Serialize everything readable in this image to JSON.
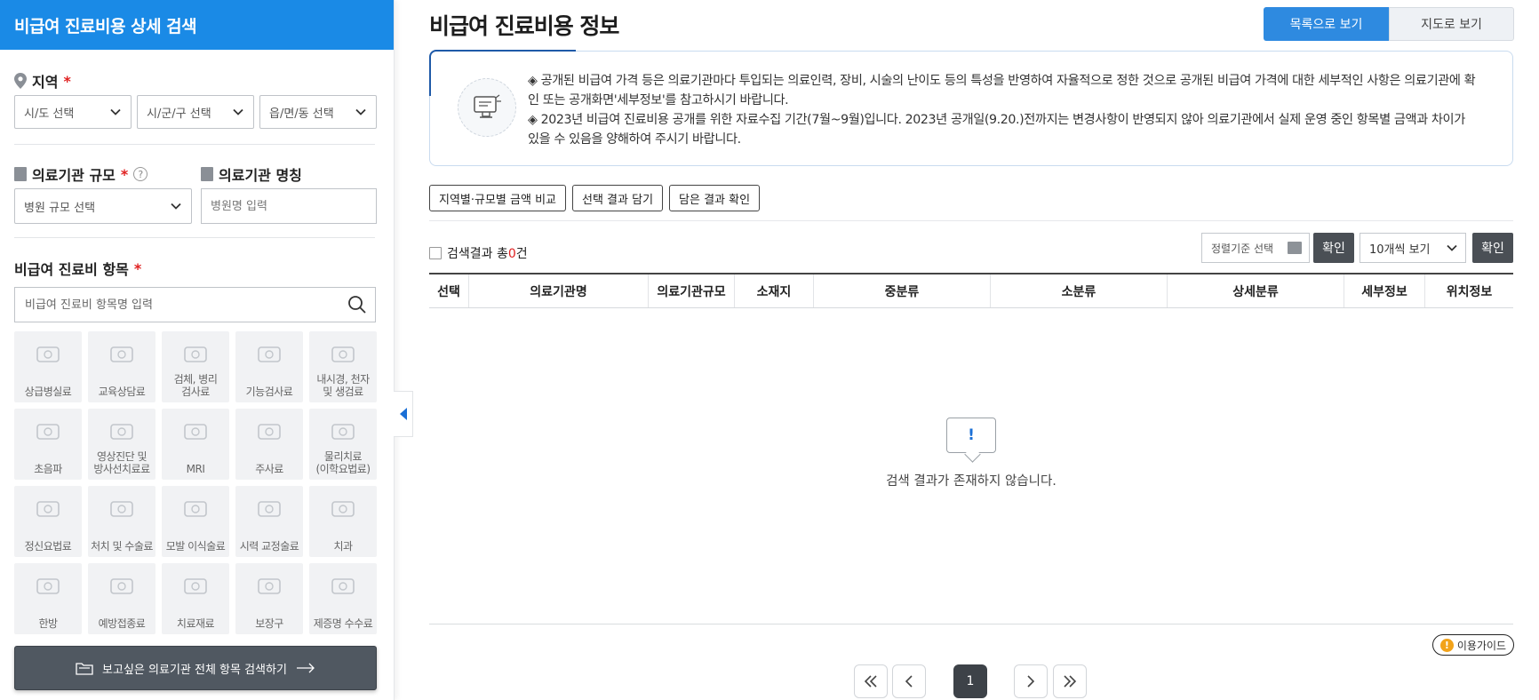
{
  "sidebar": {
    "title": "비급여 진료비용 상세 검색",
    "region": {
      "label": "지역",
      "required": "*",
      "sido": "시/도 선택",
      "sigungu": "시/군/구 선택",
      "dong": "읍/면/동 선택"
    },
    "scale": {
      "label": "의료기관 규모",
      "required": "*",
      "help": "?",
      "select": "병원 규모 선택"
    },
    "name": {
      "label": "의료기관 명칭",
      "placeholder": "병원명 입력"
    },
    "items": {
      "label": "비급여 진료비 항목",
      "required": "*",
      "search_placeholder": "비급여 진료비 항목명 입력",
      "categories": [
        {
          "label": "상급병실료",
          "icon": "bed-icon"
        },
        {
          "label": "교육상담료",
          "icon": "counseling-icon"
        },
        {
          "label": "검체, 병리\n검사료",
          "icon": "specimen-icon"
        },
        {
          "label": "기능검사료",
          "icon": "function-test-icon"
        },
        {
          "label": "내시경, 천자\n및 생검료",
          "icon": "endoscope-icon"
        },
        {
          "label": "초음파",
          "icon": "ultrasound-icon"
        },
        {
          "label": "영상진단 및\n방사선치료료",
          "icon": "radiology-icon"
        },
        {
          "label": "MRI",
          "icon": "mri-icon"
        },
        {
          "label": "주사료",
          "icon": "injection-icon"
        },
        {
          "label": "물리치료\n(이학요법료)",
          "icon": "physical-therapy-icon"
        },
        {
          "label": "정신요법료",
          "icon": "psychotherapy-icon"
        },
        {
          "label": "처치 및 수술료",
          "icon": "surgery-icon"
        },
        {
          "label": "모발 이식술료",
          "icon": "hair-transplant-icon"
        },
        {
          "label": "시력 교정술료",
          "icon": "eye-icon"
        },
        {
          "label": "치과",
          "icon": "tooth-icon"
        },
        {
          "label": "한방",
          "icon": "ear-icon"
        },
        {
          "label": "예방접종료",
          "icon": "vaccine-icon"
        },
        {
          "label": "치료재료",
          "icon": "material-icon"
        },
        {
          "label": "보장구",
          "icon": "wheelchair-icon"
        },
        {
          "label": "제증명 수수료",
          "icon": "certificate-icon"
        }
      ]
    },
    "full_search_button": "보고싶은 의료기관 전체 항목 검색하기"
  },
  "main": {
    "title": "비급여 진료비용 정보",
    "view_tabs": {
      "list": "목록으로 보기",
      "map": "지도로 보기"
    },
    "notice_lines": [
      "◈ 공개된 비급여 가격 등은 의료기관마다 투입되는 의료인력, 장비, 시술의 난이도 등의 특성을 반영하여 자율적으로 정한 것으로 공개된 비급여 가격에 대한 세부적인 사항은 의료기관에 확인 또는 공개화면'세부정보'를 참고하시기 바랍니다.",
      "◈ 2023년 비급여 진료비용 공개를 위한 자료수집 기간(7월~9월)입니다. 2023년 공개일(9.20.)전까지는 변경사항이 반영되지 않아 의료기관에서 실제 운영 중인 항목별 금액과 차이가 있을 수 있음을 양해하여 주시기 바랍니다."
    ],
    "actions": {
      "compare": "지역별·규모별 금액 비교",
      "save": "선택 결과 담기",
      "check": "담은 결과 확인"
    },
    "result": {
      "prefix": "검색결과 총",
      "count": "0",
      "suffix": "건"
    },
    "sort": {
      "label": "정렬기준 선택",
      "confirm": "확인"
    },
    "per_page": {
      "label": "10개씩 보기",
      "confirm": "확인"
    },
    "columns": [
      "선택",
      "의료기관명",
      "의료기관규모",
      "소재지",
      "중분류",
      "소분류",
      "상세분류",
      "세부정보",
      "위치정보"
    ],
    "empty_icon": "!",
    "empty_message": "검색 결과가 존재하지 않습니다.",
    "guide": {
      "icon": "!",
      "label": "이용가이드"
    },
    "pagination": {
      "current": "1"
    }
  },
  "colors": {
    "accent": "#1a8ae6",
    "tab_active": "#2e8ae0",
    "dark_button": "#4a4f55",
    "required": "#e02020"
  }
}
